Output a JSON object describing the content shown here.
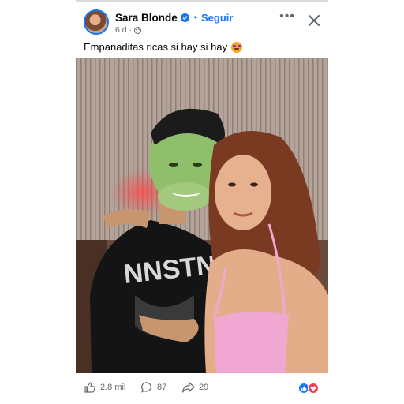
{
  "post": {
    "author": "Sara Blonde",
    "follow_label": "Seguir",
    "time": "6 d",
    "meta_separator": "·",
    "caption": "Empanaditas ricas si hay si hay",
    "caption_emoji": "star-struck-emoji"
  },
  "actions": {
    "likes": "2.8 mil",
    "comments": "87",
    "shares": "29"
  },
  "colors": {
    "accent": "#1877f2",
    "text": "#050505",
    "muted": "#65676b"
  }
}
